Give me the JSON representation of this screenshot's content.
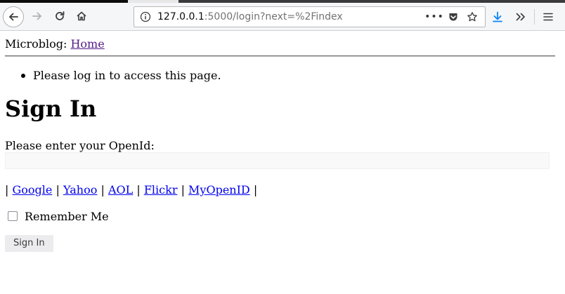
{
  "browser": {
    "url_prefix": "127.0.0.1",
    "url_rest": ":5000/login?next=%2Findex",
    "icons": [
      "back-icon",
      "forward-icon",
      "reload-icon",
      "home-icon",
      "info-icon",
      "page-actions-icon",
      "pocket-icon",
      "bookmark-star-icon",
      "download-icon",
      "overflow-icon",
      "menu-icon"
    ]
  },
  "header": {
    "site_name": "Microblog:",
    "home_link": "Home"
  },
  "flash": {
    "message": "Please log in to access this page."
  },
  "form": {
    "title": "Sign In",
    "prompt": "Please enter your OpenId:",
    "openid_value": "",
    "providers_sep": "|",
    "providers": [
      "Google",
      "Yahoo",
      "AOL",
      "Flickr",
      "MyOpenID"
    ],
    "remember_label": "Remember Me",
    "remember_checked": false,
    "submit_label": "Sign In"
  }
}
